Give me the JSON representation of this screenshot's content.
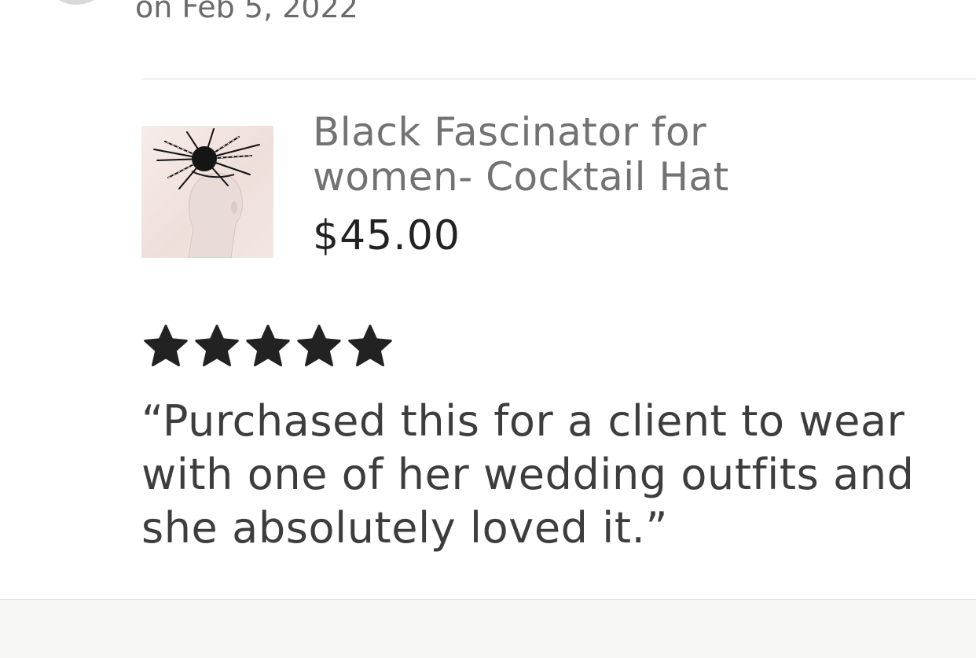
{
  "review": {
    "date_text": "on Feb 5, 2022",
    "rating": 5,
    "rating_max": 5,
    "text": "“Purchased this for a client to wear with one of her wedding outfits and she absolutely loved it.”"
  },
  "product": {
    "title": "Black Fascinator for women- Cocktail Hat",
    "price": "$45.00"
  },
  "icons": {
    "star": "star-icon",
    "thumbnail": "product-image"
  },
  "colors": {
    "star": "#222222",
    "price": "#222222",
    "title": "#727272",
    "review_text": "#3d3d3d"
  }
}
